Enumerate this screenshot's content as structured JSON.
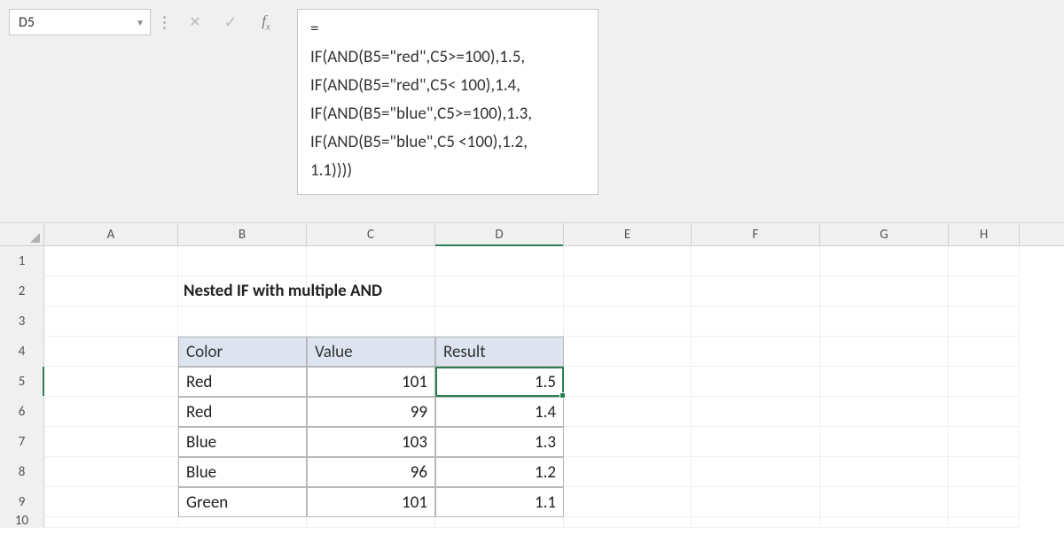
{
  "namebox": {
    "value": "D5"
  },
  "formula": {
    "l1": "=",
    "l2": "IF(AND(B5=\"red\",C5>=100),1.5,",
    "l3": "IF(AND(B5=\"red\",C5< 100),1.4,",
    "l4": "IF(AND(B5=\"blue\",C5>=100),1.3,",
    "l5": "IF(AND(B5=\"blue\",C5 <100),1.2,",
    "l6": "1.1))))"
  },
  "columns": [
    "A",
    "B",
    "C",
    "D",
    "E",
    "F",
    "G",
    "H"
  ],
  "rows": [
    "1",
    "2",
    "3",
    "4",
    "5",
    "6",
    "7",
    "8",
    "9",
    "10"
  ],
  "title": "Nested IF with multiple AND",
  "table": {
    "headers": {
      "color": "Color",
      "value": "Value",
      "result": "Result"
    },
    "rows": [
      {
        "color": "Red",
        "value": "101",
        "result": "1.5"
      },
      {
        "color": "Red",
        "value": "99",
        "result": "1.4"
      },
      {
        "color": "Blue",
        "value": "103",
        "result": "1.3"
      },
      {
        "color": "Blue",
        "value": "96",
        "result": "1.2"
      },
      {
        "color": "Green",
        "value": "101",
        "result": "1.1"
      }
    ]
  },
  "selected_cell": "D5"
}
